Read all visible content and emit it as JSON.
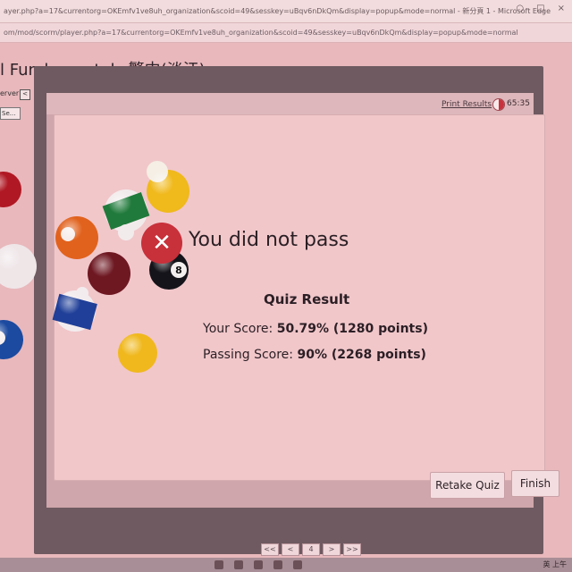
{
  "browser": {
    "title": "ayer.php?a=17&currentorg=OKEmfv1ve8uh_organization&scoid=49&sesskey=uBqv6nDkQm&display=popup&mode=normal - 新分頁 1 - Microsoft Edge",
    "address": "om/mod/scorm/player.php?a=17&currentorg=OKEmfv1ve8uh_organization&scoid=49&sesskey=uBqv6nDkQm&display=popup&mode=normal",
    "window_controls": [
      "○",
      "□",
      "×"
    ]
  },
  "course": {
    "title": "l Fundamentals 繁中(淡江)"
  },
  "side_panel": {
    "server_label": "erver",
    "collapse_glyph": "<",
    "select_text": "Se..."
  },
  "player": {
    "print_results": "Print Results",
    "timer": "65:35",
    "result_heading": "You did not pass",
    "fail_glyph": "✕",
    "quiz_result_title": "Quiz Result",
    "score_label": "Your Score: ",
    "score_value": "50.79% (1280 points)",
    "passing_label": "Passing Score: ",
    "passing_value": "90% (2268 points)",
    "retake_label": "Retake Quiz",
    "finish_label": "Finish"
  },
  "pager": [
    "<<",
    "<",
    "4",
    ">",
    ">>"
  ],
  "taskbar": {
    "tray_text": "英",
    "clock": "上午"
  },
  "colors": {
    "fail_red": "#c8303a",
    "frame": "#6e5a60",
    "card": "#f1c7ca"
  },
  "billiard_balls": [
    {
      "number": "",
      "kind": "solid red"
    },
    {
      "number": "",
      "kind": "cue white"
    },
    {
      "number": "",
      "kind": "solid blue"
    },
    {
      "number": "",
      "kind": "solid orange"
    },
    {
      "number": "",
      "kind": "stripe green"
    },
    {
      "number": "",
      "kind": "solid yellow"
    },
    {
      "number": "",
      "kind": "solid maroon"
    },
    {
      "number": "8",
      "kind": "eight ball"
    },
    {
      "number": "",
      "kind": "stripe blue"
    },
    {
      "number": "",
      "kind": "solid yellow"
    }
  ]
}
